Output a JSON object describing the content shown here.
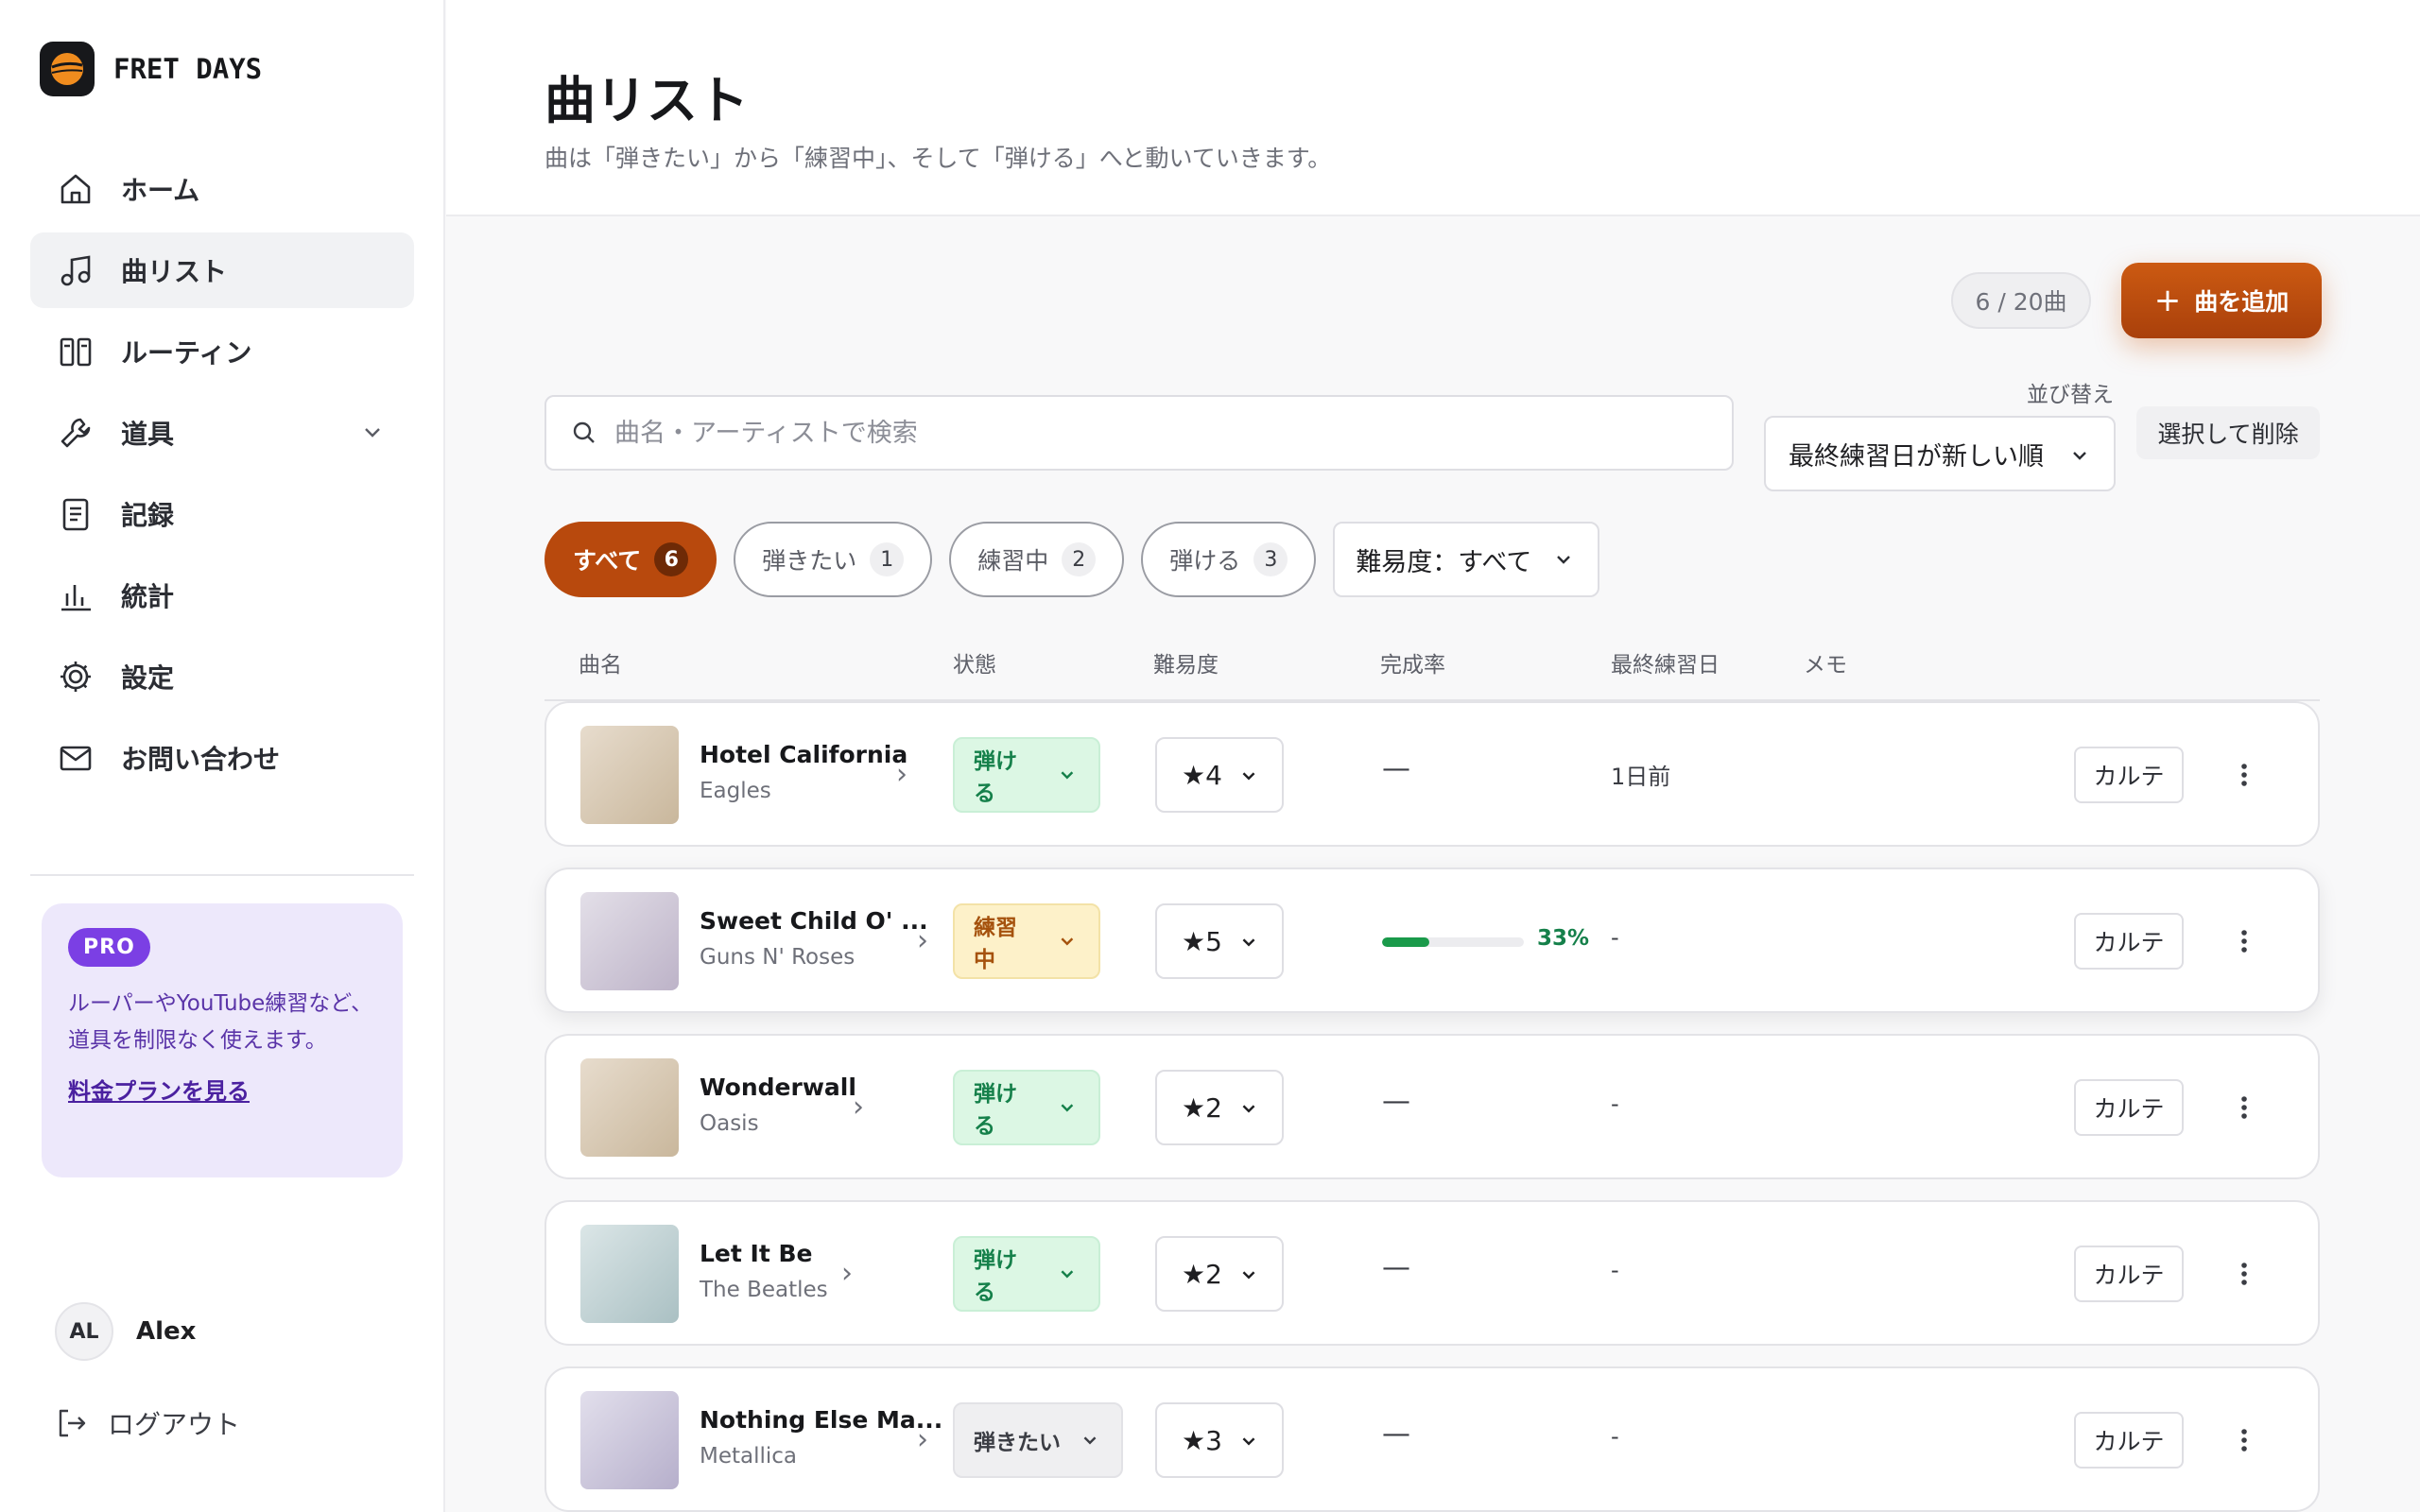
{
  "app": {
    "brand": "FRET DAYS"
  },
  "sidebar": {
    "items": [
      {
        "label": "ホーム",
        "icon": "home-icon"
      },
      {
        "label": "曲リスト",
        "icon": "music-note-icon",
        "active": true
      },
      {
        "label": "ルーティン",
        "icon": "routine-icon"
      },
      {
        "label": "道具",
        "icon": "wrench-icon",
        "expandable": true
      },
      {
        "label": "記録",
        "icon": "notebook-icon"
      },
      {
        "label": "統計",
        "icon": "bar-chart-icon"
      },
      {
        "label": "設定",
        "icon": "gear-icon"
      },
      {
        "label": "お問い合わせ",
        "icon": "mail-icon"
      }
    ],
    "pro": {
      "badge": "PRO",
      "text": "ルーパーやYouTube練習など、道具を制限なく使えます。",
      "link": "料金プランを見る"
    },
    "user": {
      "initials": "AL",
      "name": "Alex"
    },
    "logout": "ログアウト"
  },
  "header": {
    "title": "曲リスト",
    "subtitle": "曲は「弾きたい」から「練習中」、そして「弾ける」へと動いていきます。"
  },
  "toolbar": {
    "count": "6 / 20曲",
    "add_label": "曲を追加",
    "search_placeholder": "曲名・アーティストで検索",
    "sort_label": "並び替え",
    "sort_value": "最終練習日が新しい順",
    "delete_label": "選択して削除"
  },
  "filters": {
    "chips": [
      {
        "label": "すべて",
        "count": "6",
        "active": true
      },
      {
        "label": "弾きたい",
        "count": "1"
      },
      {
        "label": "練習中",
        "count": "2"
      },
      {
        "label": "弾ける",
        "count": "3"
      }
    ],
    "difficulty": "難易度：すべて"
  },
  "table": {
    "columns": [
      "曲名",
      "状態",
      "難易度",
      "完成率",
      "最終練習日",
      "メモ"
    ],
    "karte_label": "カルテ",
    "rows": [
      {
        "title": "Hotel California",
        "artist": "Eagles",
        "status": "弾ける",
        "status_tone": "green",
        "difficulty": "★4",
        "progress": null,
        "progress_text": "—",
        "last": "1日前",
        "thumb": [
          "#e7dccd",
          "#c9b79c"
        ]
      },
      {
        "title": "Sweet Child O' ...",
        "artist": "Guns N' Roses",
        "status": "練習中",
        "status_tone": "yellow",
        "difficulty": "★5",
        "progress": 0.33,
        "progress_text": "33%",
        "last": "-",
        "thumb": [
          "#e3dfe8",
          "#bdb3c8"
        ]
      },
      {
        "title": "Wonderwall",
        "artist": "Oasis",
        "status": "弾ける",
        "status_tone": "green",
        "difficulty": "★2",
        "progress": null,
        "progress_text": "—",
        "last": "-",
        "thumb": [
          "#e7dccd",
          "#c9b79c"
        ]
      },
      {
        "title": "Let It Be",
        "artist": "The Beatles",
        "status": "弾ける",
        "status_tone": "green",
        "difficulty": "★2",
        "progress": null,
        "progress_text": "—",
        "last": "-",
        "thumb": [
          "#dbe6e7",
          "#aac0c3"
        ]
      },
      {
        "title": "Nothing Else Ma...",
        "artist": "Metallica",
        "status": "弾きたい",
        "status_tone": "gray",
        "difficulty": "★3",
        "progress": null,
        "progress_text": "—",
        "last": "-",
        "thumb": [
          "#e2dfec",
          "#b6afcb"
        ]
      }
    ]
  },
  "colors": {
    "accent": "#b8490d",
    "pro": "#7b3fe4",
    "success": "#15804a"
  }
}
